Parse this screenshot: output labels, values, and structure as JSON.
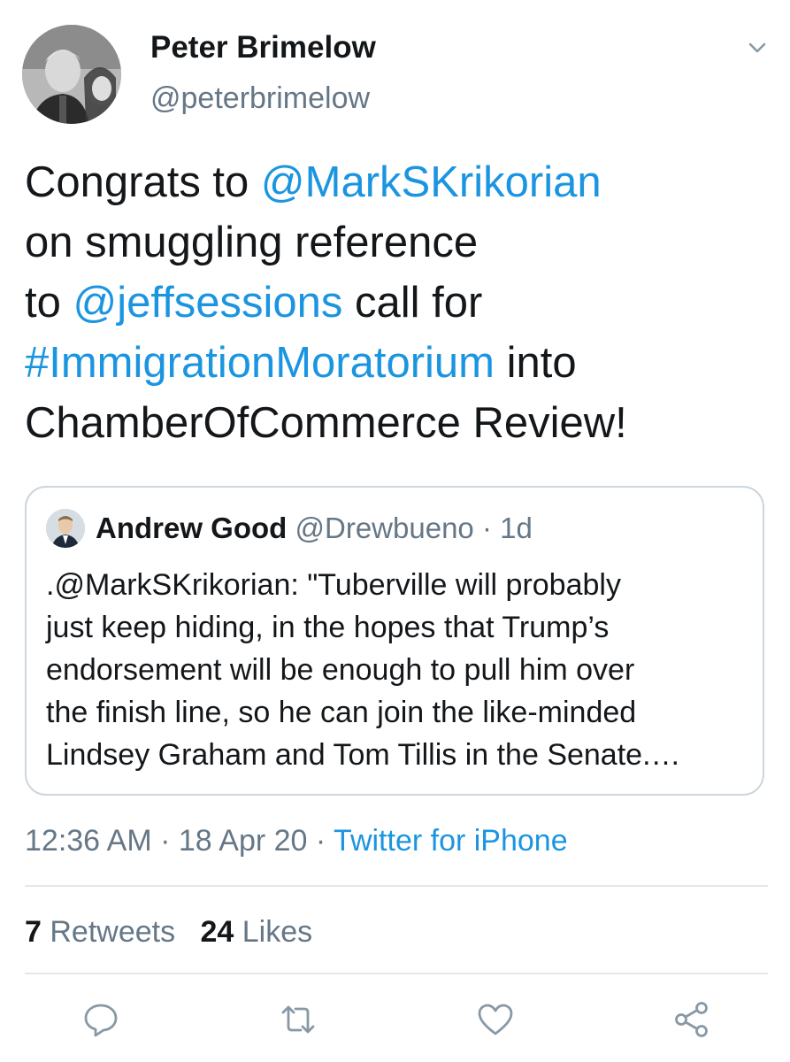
{
  "author": {
    "name": "Peter Brimelow",
    "handle": "@peterbrimelow"
  },
  "tweet": {
    "lines": [
      [
        {
          "text": "Congrats to ",
          "link": false
        },
        {
          "text": "@MarkSKrikorian",
          "link": true
        }
      ],
      [
        {
          "text": "on smuggling reference",
          "link": false
        }
      ],
      [
        {
          "text": "to ",
          "link": false
        },
        {
          "text": "@jeffsessions",
          "link": true
        },
        {
          "text": " call for",
          "link": false
        }
      ],
      [
        {
          "text": "#ImmigrationMoratorium",
          "link": true
        },
        {
          "text": " into",
          "link": false
        }
      ],
      [
        {
          "text": "ChamberOfCommerce Review!",
          "link": false
        }
      ]
    ]
  },
  "quote": {
    "name": "Andrew Good",
    "handle": "@Drewbueno",
    "separator": " · ",
    "time": "1d",
    "lines": [
      ".@MarkSKrikorian: \"Tuberville will probably",
      "just keep hiding, in the hopes that Trump’s",
      "endorsement will be enough to pull him over",
      "the finish line, so he can join the like-minded",
      "Lindsey Graham and Tom Tillis in the Senate.…"
    ]
  },
  "meta": {
    "time": "12:36 AM",
    "separator": " · ",
    "date": "18 Apr 20",
    "source": "Twitter for iPhone"
  },
  "stats": {
    "retweets_count": "7",
    "retweets_label": "Retweets",
    "likes_count": "24",
    "likes_label": "Likes"
  },
  "actions": [
    {
      "icon": "reply-icon"
    },
    {
      "icon": "retweet-icon"
    },
    {
      "icon": "like-icon"
    },
    {
      "icon": "share-icon"
    }
  ],
  "colors": {
    "link": "#1b95e0",
    "muted": "#657786",
    "text": "#14171a",
    "border": "#ccd6dd"
  }
}
